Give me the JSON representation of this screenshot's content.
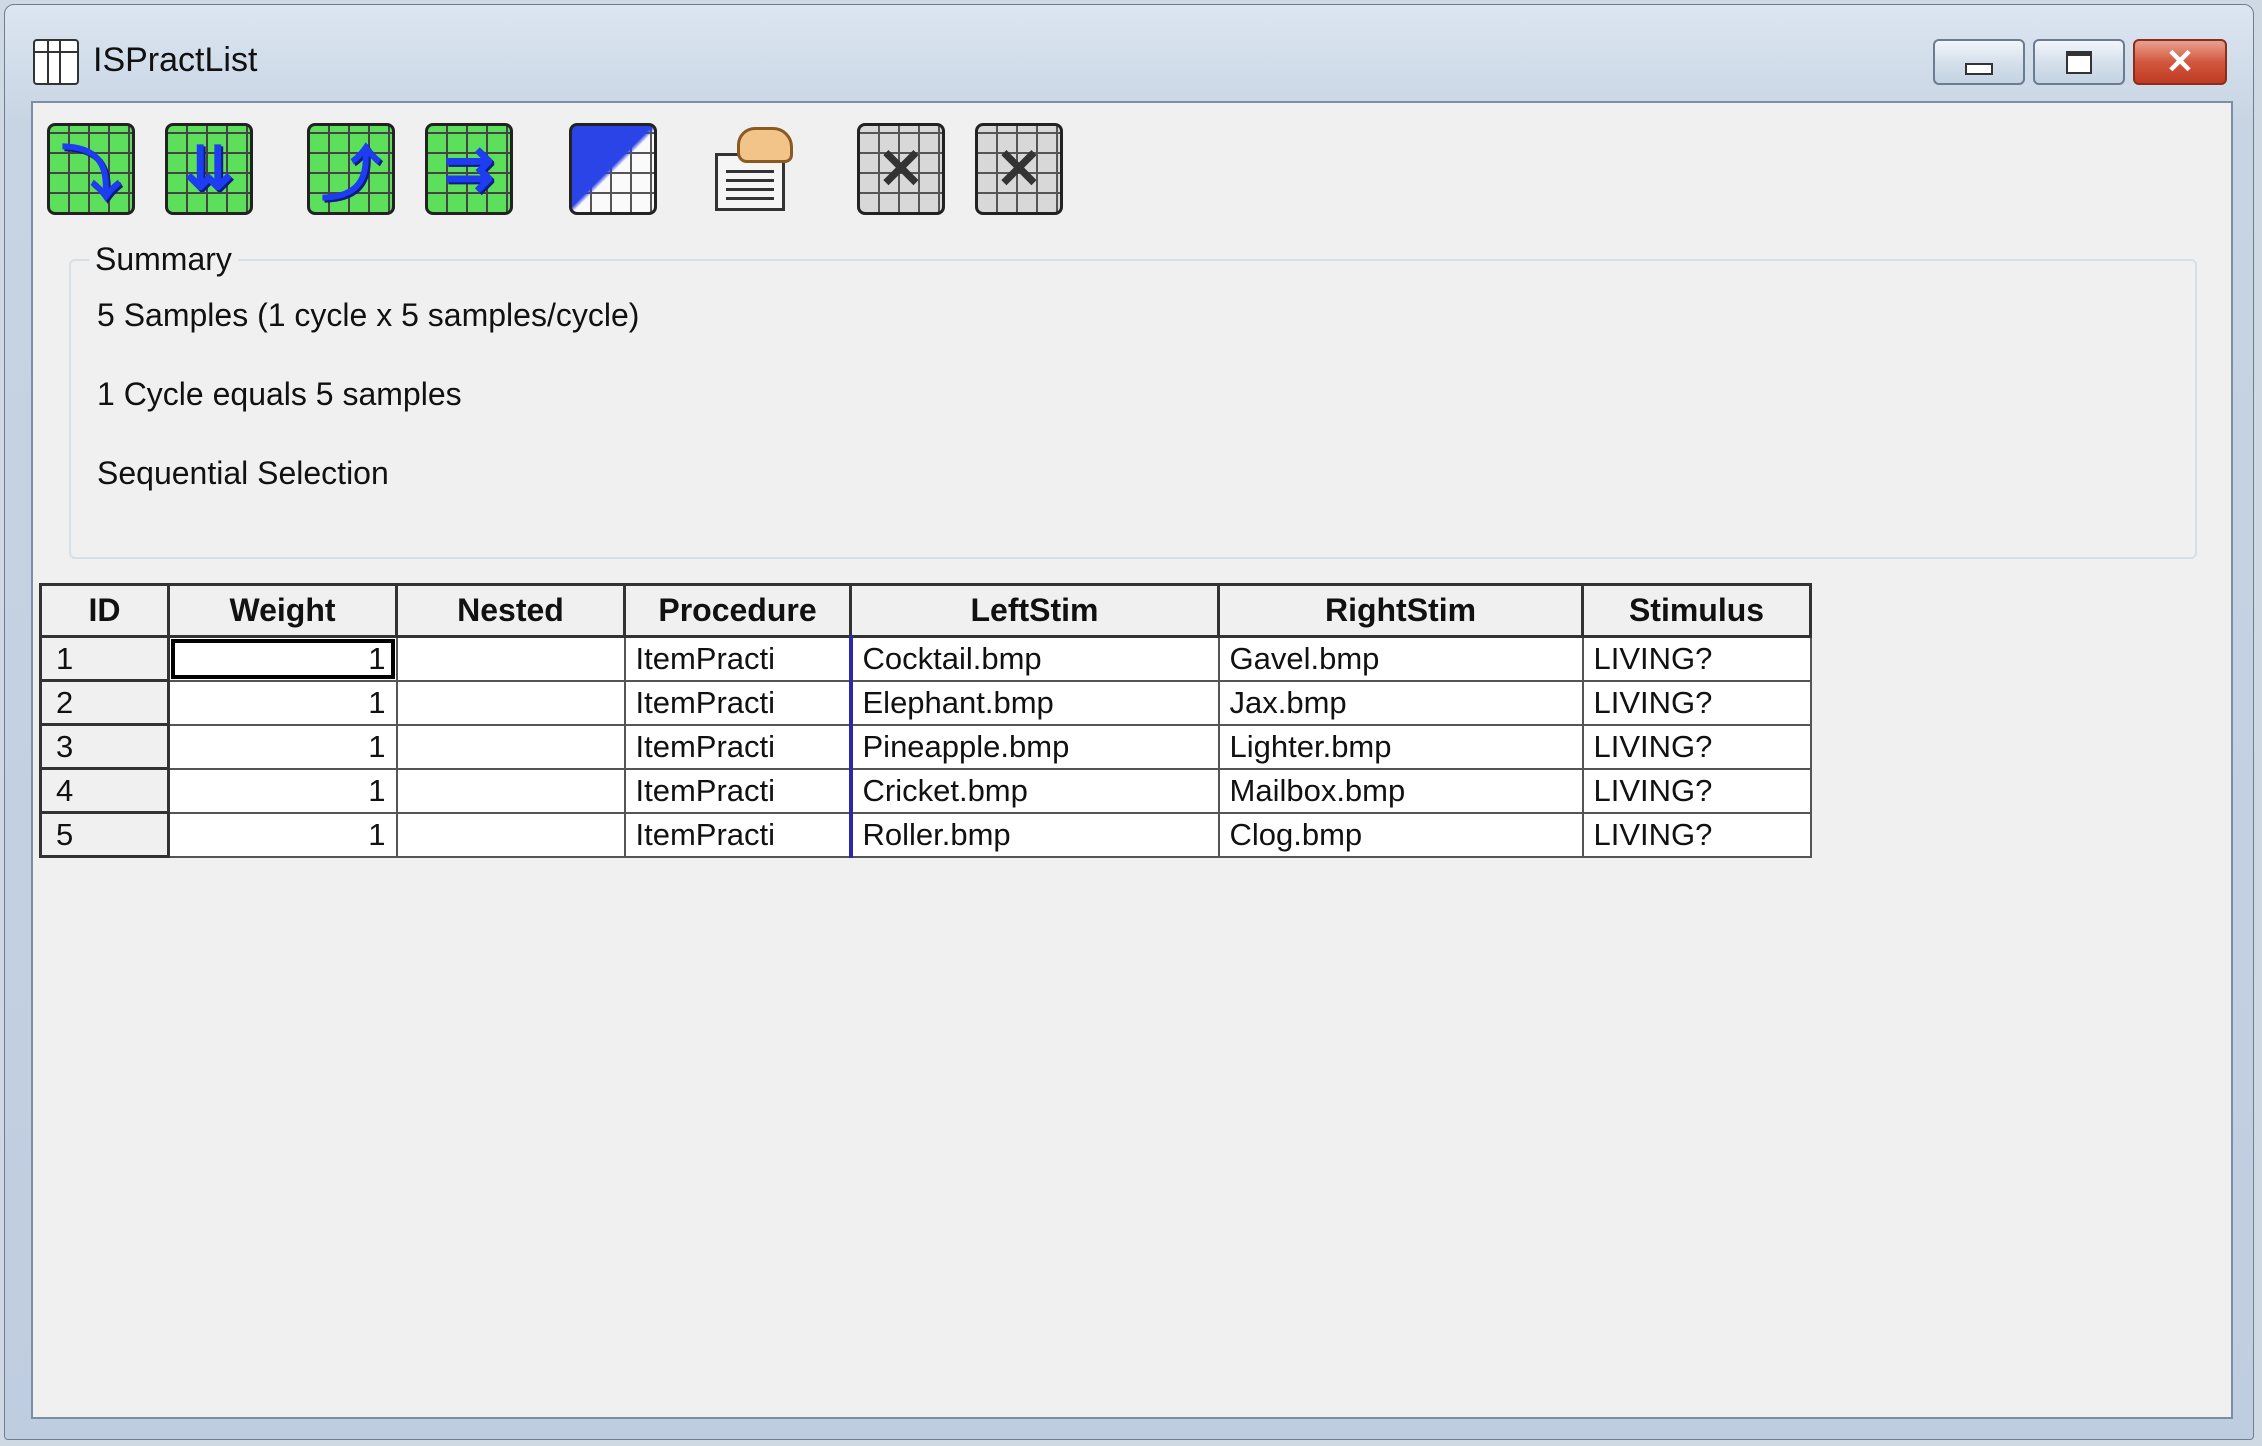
{
  "window": {
    "title": "ISPractList",
    "minimize_symbol": "▁",
    "maximize_symbol": "□",
    "close_symbol": "✕"
  },
  "toolbar": {
    "buttons": [
      {
        "icon": "add-level-icon"
      },
      {
        "icon": "add-multiple-levels-icon"
      },
      {
        "icon": "add-attribute-icon"
      },
      {
        "icon": "add-multiple-attributes-icon"
      },
      {
        "icon": "grid-fill-icon"
      },
      {
        "icon": "properties-icon"
      },
      {
        "icon": "remove-levels-icon"
      },
      {
        "icon": "remove-attributes-icon"
      }
    ]
  },
  "summary": {
    "legend": "Summary",
    "line1": "5 Samples (1 cycle x 5 samples/cycle)",
    "line2": "1 Cycle equals 5 samples",
    "line3": "Sequential Selection"
  },
  "table": {
    "columns": [
      "ID",
      "Weight",
      "Nested",
      "Procedure",
      "LeftStim",
      "RightStim",
      "Stimulus"
    ],
    "rows": [
      {
        "id": "1",
        "weight": "1",
        "nested": "",
        "procedure": "ItemPracti",
        "leftstim": "Cocktail.bmp",
        "rightstim": "Gavel.bmp",
        "stimulus": "LIVING?"
      },
      {
        "id": "2",
        "weight": "1",
        "nested": "",
        "procedure": "ItemPracti",
        "leftstim": "Elephant.bmp",
        "rightstim": "Jax.bmp",
        "stimulus": "LIVING?"
      },
      {
        "id": "3",
        "weight": "1",
        "nested": "",
        "procedure": "ItemPracti",
        "leftstim": "Pineapple.bmp",
        "rightstim": "Lighter.bmp",
        "stimulus": "LIVING?"
      },
      {
        "id": "4",
        "weight": "1",
        "nested": "",
        "procedure": "ItemPracti",
        "leftstim": "Cricket.bmp",
        "rightstim": "Mailbox.bmp",
        "stimulus": "LIVING?"
      },
      {
        "id": "5",
        "weight": "1",
        "nested": "",
        "procedure": "ItemPracti",
        "leftstim": "Roller.bmp",
        "rightstim": "Clog.bmp",
        "stimulus": "LIVING?"
      }
    ]
  }
}
